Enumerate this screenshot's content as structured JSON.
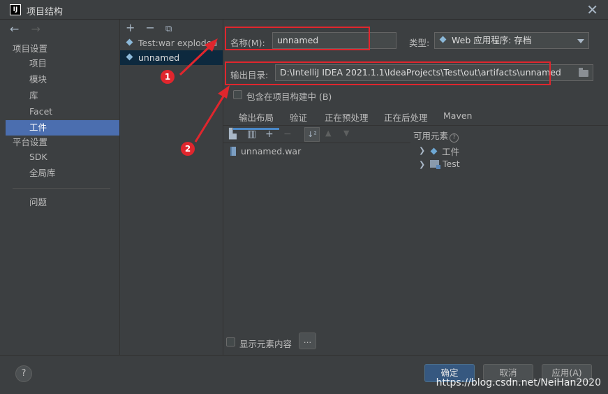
{
  "window": {
    "title": "项目结构",
    "app_icon_text": "IJ",
    "close_icon": "close-icon"
  },
  "nav": {
    "back_icon": "←",
    "forward_icon": "→",
    "section_project": "项目设置",
    "items_project": [
      "项目",
      "模块",
      "库",
      "Facet",
      "工件"
    ],
    "section_platform": "平台设置",
    "items_platform": [
      "SDK",
      "全局库"
    ],
    "problems": "问题",
    "selected": "工件"
  },
  "artifacts": {
    "add_icon": "+",
    "remove_icon": "−",
    "copy_icon": "⧉",
    "items": [
      "Test:war exploded",
      "unnamed"
    ],
    "selected": "unnamed"
  },
  "form": {
    "name_label": "名称(M):",
    "name_value": "unnamed",
    "type_label": "类型:",
    "type_value": "Web 应用程序: 存档",
    "output_label": "输出目录:",
    "output_value": "D:\\IntelliJ IDEA 2021.1.1\\IdeaProjects\\Test\\out\\artifacts\\unnamed",
    "include_build_label": "包含在项目构建中 (B)"
  },
  "tabs": [
    "输出布局",
    "验证",
    "正在预处理",
    "正在后处理",
    "Maven"
  ],
  "active_tab": "输出布局",
  "layout": {
    "output_tree": [
      "unnamed.war"
    ],
    "available_title": "可用元素",
    "available_items": [
      "工件",
      "Test"
    ],
    "show_content_label": "显示元素内容",
    "ellipsis_label": "..."
  },
  "buttons": {
    "help": "?",
    "ok": "确定",
    "cancel": "取消",
    "apply": "应用(A)"
  },
  "annotations": {
    "badge1": "1",
    "badge2": "2",
    "color": "#e0262d"
  },
  "watermark": "https://blog.csdn.net/NeiHan2020"
}
